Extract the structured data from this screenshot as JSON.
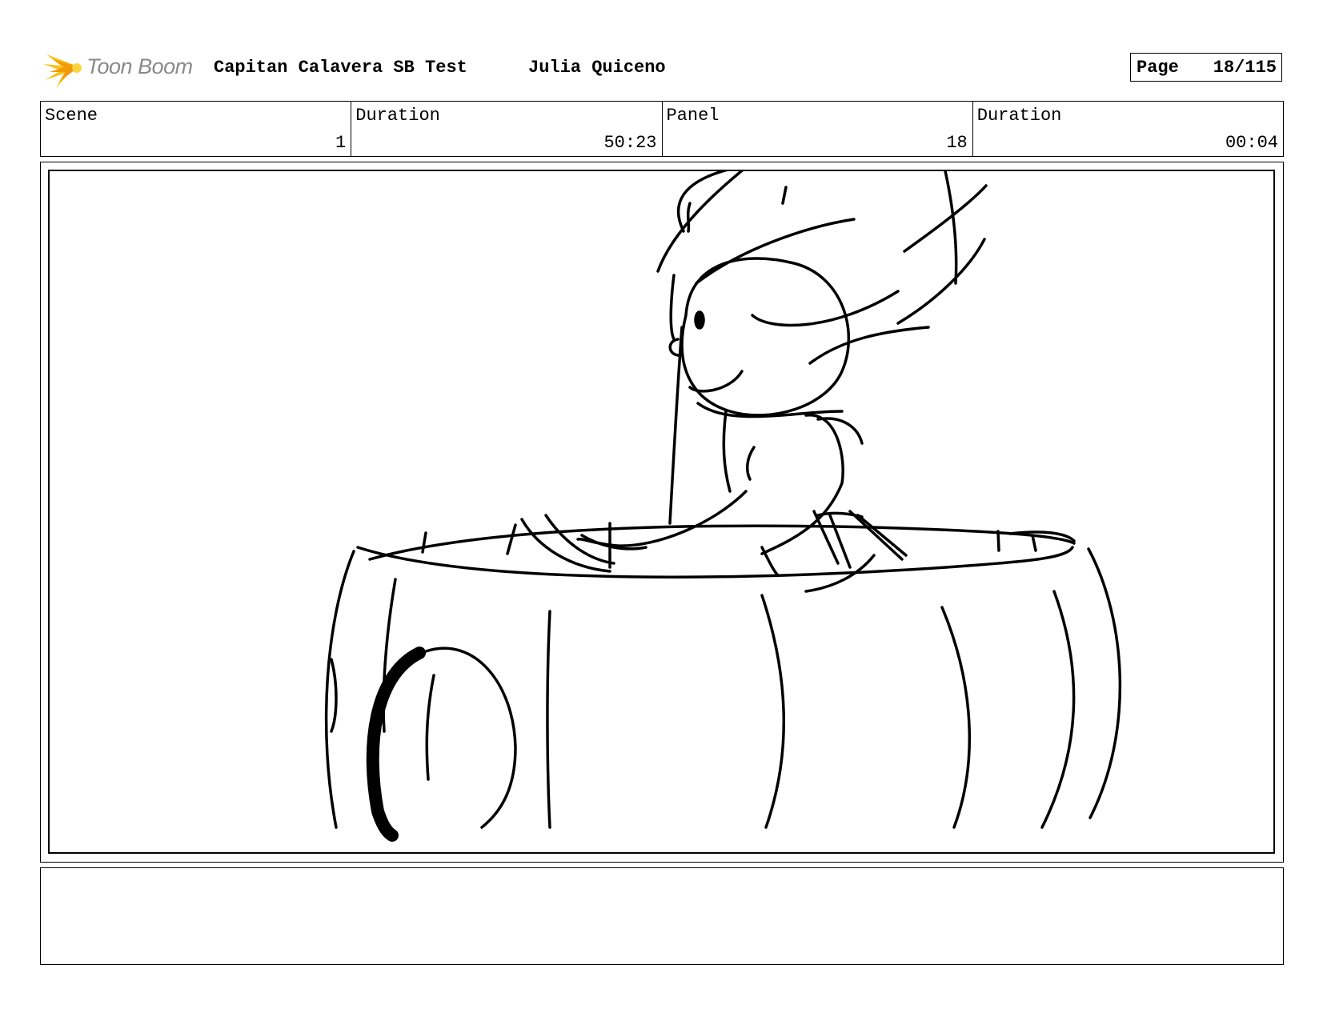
{
  "header": {
    "logo_text": "Toon Boom",
    "project_title": "Capitan Calavera SB Test",
    "author": "Julia Quiceno",
    "page_label": "Page",
    "page_value": "18/115"
  },
  "info": {
    "scene_label": "Scene",
    "scene_value": "1",
    "scene_duration_label": "Duration",
    "scene_duration_value": "50:23",
    "panel_label": "Panel",
    "panel_value": "18",
    "panel_duration_label": "Duration",
    "panel_duration_value": "00:04"
  },
  "notes": {
    "text": ""
  }
}
